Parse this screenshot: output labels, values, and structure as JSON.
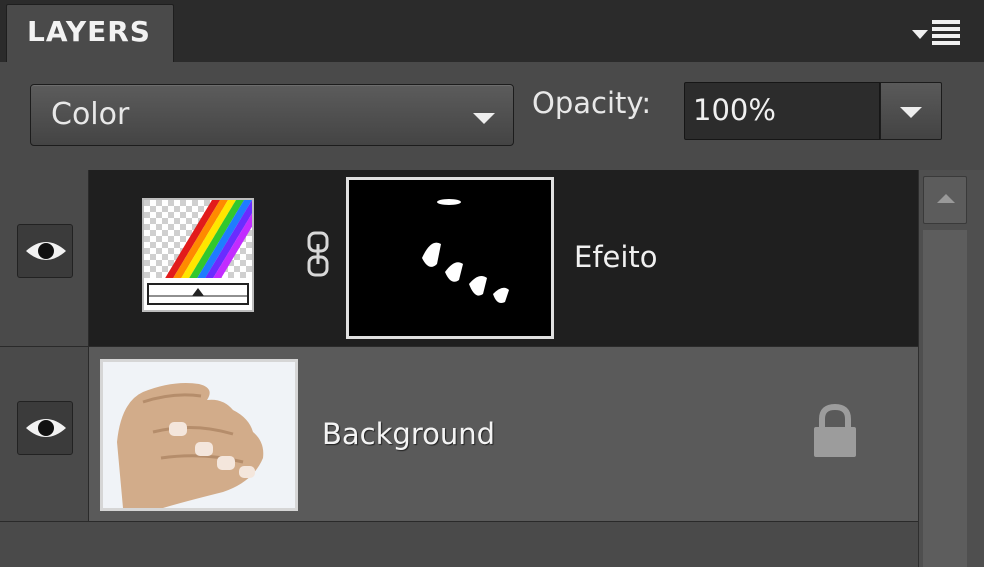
{
  "panel": {
    "tab_label": "LAYERS",
    "menu_icon": "panel-menu-icon"
  },
  "blend_mode": {
    "selected": "Color",
    "icon": "chevron-down-icon"
  },
  "opacity": {
    "label": "Opacity:",
    "value": "100%",
    "icon": "chevron-down-icon"
  },
  "layers": [
    {
      "name": "Efeito",
      "visible": true,
      "selected": true,
      "icons": [
        "eye-icon",
        "gradient-map-icon",
        "link-icon",
        "layer-mask-icon"
      ]
    },
    {
      "name": "Background",
      "visible": true,
      "selected": false,
      "locked": true,
      "icons": [
        "eye-icon",
        "lock-icon"
      ]
    }
  ],
  "colors": {
    "panel_bg": "#4a4a4a",
    "selected_row": "#1f1f1f",
    "text": "#f0f0f0"
  }
}
